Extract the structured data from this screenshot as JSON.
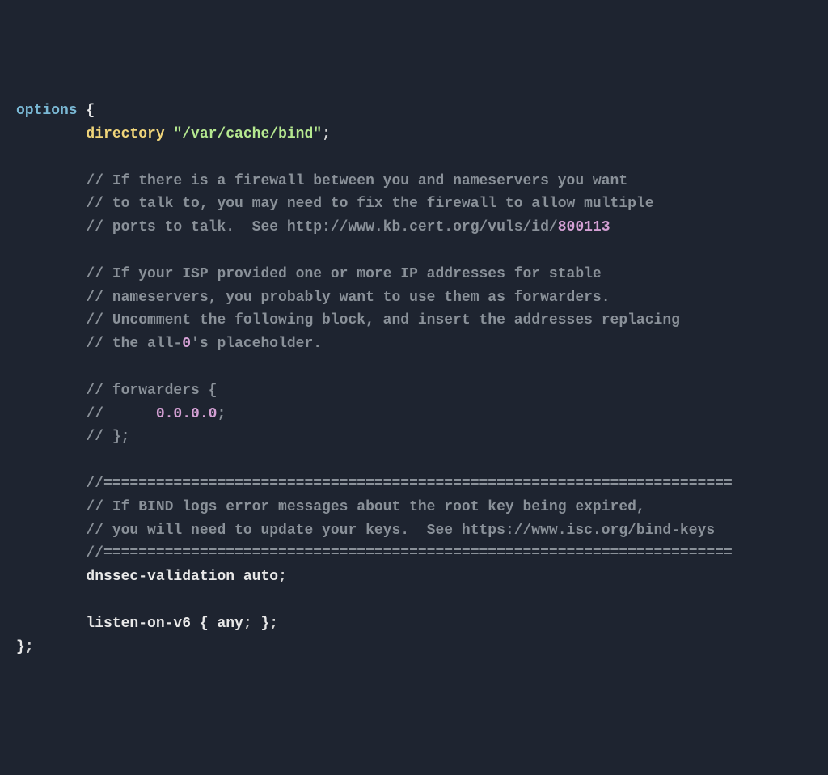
{
  "code": {
    "l01_kw": "options",
    "l01_brace": " {",
    "l02_dir": "        directory",
    "l02_str": " \"/var/cache/bind\"",
    "l02_semi": ";",
    "l04": "        // If there is a firewall between you and nameservers you want",
    "l05": "        // to talk to, you may need to fix the firewall to allow multiple",
    "l06a": "        // ports to talk.  See http://www.kb.cert.org/vuls/id/",
    "l06b": "800113",
    "l08": "        // If your ISP provided one or more IP addresses for stable",
    "l09": "        // nameservers, you probably want to use them as forwarders.",
    "l10": "        // Uncomment the following block, and insert the addresses replacing",
    "l11a": "        // the all-",
    "l11b": "0",
    "l11c": "'s placeholder.",
    "l13": "        // forwarders {",
    "l14a": "        //      ",
    "l14b": "0.0.0.0",
    "l14c": ";",
    "l15": "        // };",
    "l17": "        //========================================================================",
    "l18": "        // If BIND logs error messages about the root key being expired,",
    "l19": "        // you will need to update your keys.  See https://www.isc.org/bind-keys",
    "l20": "        //========================================================================",
    "l21a": "        dnssec-validation auto",
    "l21b": ";",
    "l23a": "        listen-on-v6 ",
    "l23b": "{",
    "l23c": " any",
    "l23d": ";",
    "l23e": " }",
    "l23f": ";",
    "l24a": "}",
    "l24b": ";"
  }
}
